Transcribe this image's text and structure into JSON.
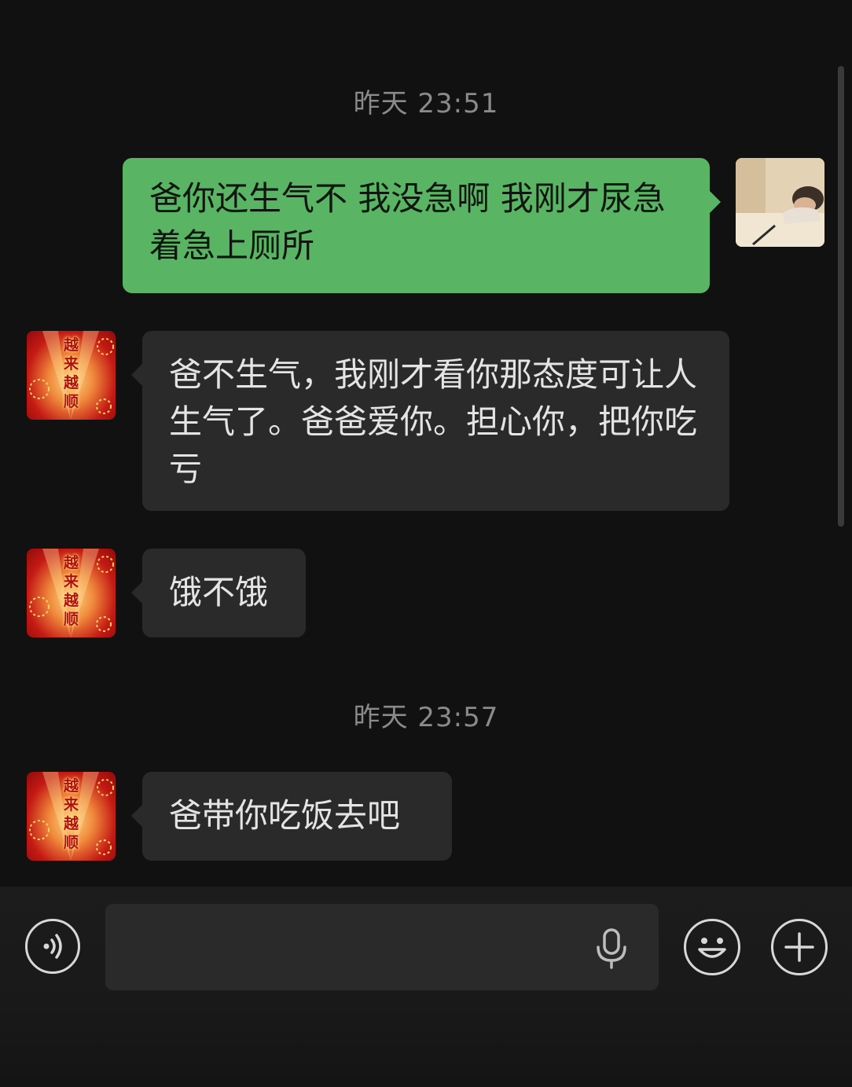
{
  "chat": {
    "timestamps": [
      "昨天 23:51",
      "昨天 23:57"
    ],
    "messages": [
      {
        "side": "sent",
        "text": "爸你还生气不 我没急啊 我刚才尿急着急上厕所"
      },
      {
        "side": "received",
        "text": "爸不生气，我刚才看你那态度可让人生气了。爸爸爱你。担心你，把你吃亏"
      },
      {
        "side": "received",
        "text": "饿不饿"
      },
      {
        "side": "received",
        "text": "爸带你吃饭去吧"
      }
    ]
  },
  "avatars": {
    "dad_avatar_text": [
      "越",
      "来",
      "越",
      "顺"
    ]
  },
  "input_bar": {
    "voice_icon": "voice-wave-icon",
    "mic_icon": "microphone-icon",
    "emoji_icon": "smiley-face-icon",
    "more_icon": "plus-icon"
  },
  "colors": {
    "background": "#111111",
    "sent_bubble": "#59b563",
    "received_bubble": "#2a2a2a",
    "timestamp_text": "#8a8a8a"
  }
}
